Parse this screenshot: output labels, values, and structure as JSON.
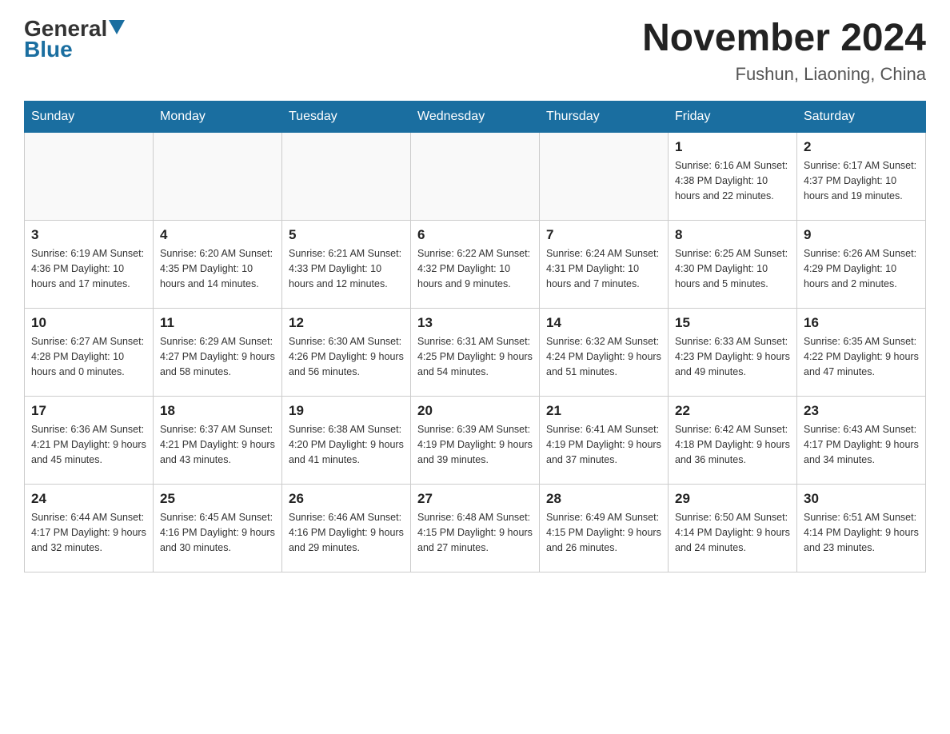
{
  "header": {
    "logo_general": "General",
    "logo_blue": "Blue",
    "month_year": "November 2024",
    "location": "Fushun, Liaoning, China"
  },
  "days_of_week": [
    "Sunday",
    "Monday",
    "Tuesday",
    "Wednesday",
    "Thursday",
    "Friday",
    "Saturday"
  ],
  "weeks": [
    [
      {
        "day": "",
        "info": ""
      },
      {
        "day": "",
        "info": ""
      },
      {
        "day": "",
        "info": ""
      },
      {
        "day": "",
        "info": ""
      },
      {
        "day": "",
        "info": ""
      },
      {
        "day": "1",
        "info": "Sunrise: 6:16 AM\nSunset: 4:38 PM\nDaylight: 10 hours\nand 22 minutes."
      },
      {
        "day": "2",
        "info": "Sunrise: 6:17 AM\nSunset: 4:37 PM\nDaylight: 10 hours\nand 19 minutes."
      }
    ],
    [
      {
        "day": "3",
        "info": "Sunrise: 6:19 AM\nSunset: 4:36 PM\nDaylight: 10 hours\nand 17 minutes."
      },
      {
        "day": "4",
        "info": "Sunrise: 6:20 AM\nSunset: 4:35 PM\nDaylight: 10 hours\nand 14 minutes."
      },
      {
        "day": "5",
        "info": "Sunrise: 6:21 AM\nSunset: 4:33 PM\nDaylight: 10 hours\nand 12 minutes."
      },
      {
        "day": "6",
        "info": "Sunrise: 6:22 AM\nSunset: 4:32 PM\nDaylight: 10 hours\nand 9 minutes."
      },
      {
        "day": "7",
        "info": "Sunrise: 6:24 AM\nSunset: 4:31 PM\nDaylight: 10 hours\nand 7 minutes."
      },
      {
        "day": "8",
        "info": "Sunrise: 6:25 AM\nSunset: 4:30 PM\nDaylight: 10 hours\nand 5 minutes."
      },
      {
        "day": "9",
        "info": "Sunrise: 6:26 AM\nSunset: 4:29 PM\nDaylight: 10 hours\nand 2 minutes."
      }
    ],
    [
      {
        "day": "10",
        "info": "Sunrise: 6:27 AM\nSunset: 4:28 PM\nDaylight: 10 hours\nand 0 minutes."
      },
      {
        "day": "11",
        "info": "Sunrise: 6:29 AM\nSunset: 4:27 PM\nDaylight: 9 hours\nand 58 minutes."
      },
      {
        "day": "12",
        "info": "Sunrise: 6:30 AM\nSunset: 4:26 PM\nDaylight: 9 hours\nand 56 minutes."
      },
      {
        "day": "13",
        "info": "Sunrise: 6:31 AM\nSunset: 4:25 PM\nDaylight: 9 hours\nand 54 minutes."
      },
      {
        "day": "14",
        "info": "Sunrise: 6:32 AM\nSunset: 4:24 PM\nDaylight: 9 hours\nand 51 minutes."
      },
      {
        "day": "15",
        "info": "Sunrise: 6:33 AM\nSunset: 4:23 PM\nDaylight: 9 hours\nand 49 minutes."
      },
      {
        "day": "16",
        "info": "Sunrise: 6:35 AM\nSunset: 4:22 PM\nDaylight: 9 hours\nand 47 minutes."
      }
    ],
    [
      {
        "day": "17",
        "info": "Sunrise: 6:36 AM\nSunset: 4:21 PM\nDaylight: 9 hours\nand 45 minutes."
      },
      {
        "day": "18",
        "info": "Sunrise: 6:37 AM\nSunset: 4:21 PM\nDaylight: 9 hours\nand 43 minutes."
      },
      {
        "day": "19",
        "info": "Sunrise: 6:38 AM\nSunset: 4:20 PM\nDaylight: 9 hours\nand 41 minutes."
      },
      {
        "day": "20",
        "info": "Sunrise: 6:39 AM\nSunset: 4:19 PM\nDaylight: 9 hours\nand 39 minutes."
      },
      {
        "day": "21",
        "info": "Sunrise: 6:41 AM\nSunset: 4:19 PM\nDaylight: 9 hours\nand 37 minutes."
      },
      {
        "day": "22",
        "info": "Sunrise: 6:42 AM\nSunset: 4:18 PM\nDaylight: 9 hours\nand 36 minutes."
      },
      {
        "day": "23",
        "info": "Sunrise: 6:43 AM\nSunset: 4:17 PM\nDaylight: 9 hours\nand 34 minutes."
      }
    ],
    [
      {
        "day": "24",
        "info": "Sunrise: 6:44 AM\nSunset: 4:17 PM\nDaylight: 9 hours\nand 32 minutes."
      },
      {
        "day": "25",
        "info": "Sunrise: 6:45 AM\nSunset: 4:16 PM\nDaylight: 9 hours\nand 30 minutes."
      },
      {
        "day": "26",
        "info": "Sunrise: 6:46 AM\nSunset: 4:16 PM\nDaylight: 9 hours\nand 29 minutes."
      },
      {
        "day": "27",
        "info": "Sunrise: 6:48 AM\nSunset: 4:15 PM\nDaylight: 9 hours\nand 27 minutes."
      },
      {
        "day": "28",
        "info": "Sunrise: 6:49 AM\nSunset: 4:15 PM\nDaylight: 9 hours\nand 26 minutes."
      },
      {
        "day": "29",
        "info": "Sunrise: 6:50 AM\nSunset: 4:14 PM\nDaylight: 9 hours\nand 24 minutes."
      },
      {
        "day": "30",
        "info": "Sunrise: 6:51 AM\nSunset: 4:14 PM\nDaylight: 9 hours\nand 23 minutes."
      }
    ]
  ]
}
